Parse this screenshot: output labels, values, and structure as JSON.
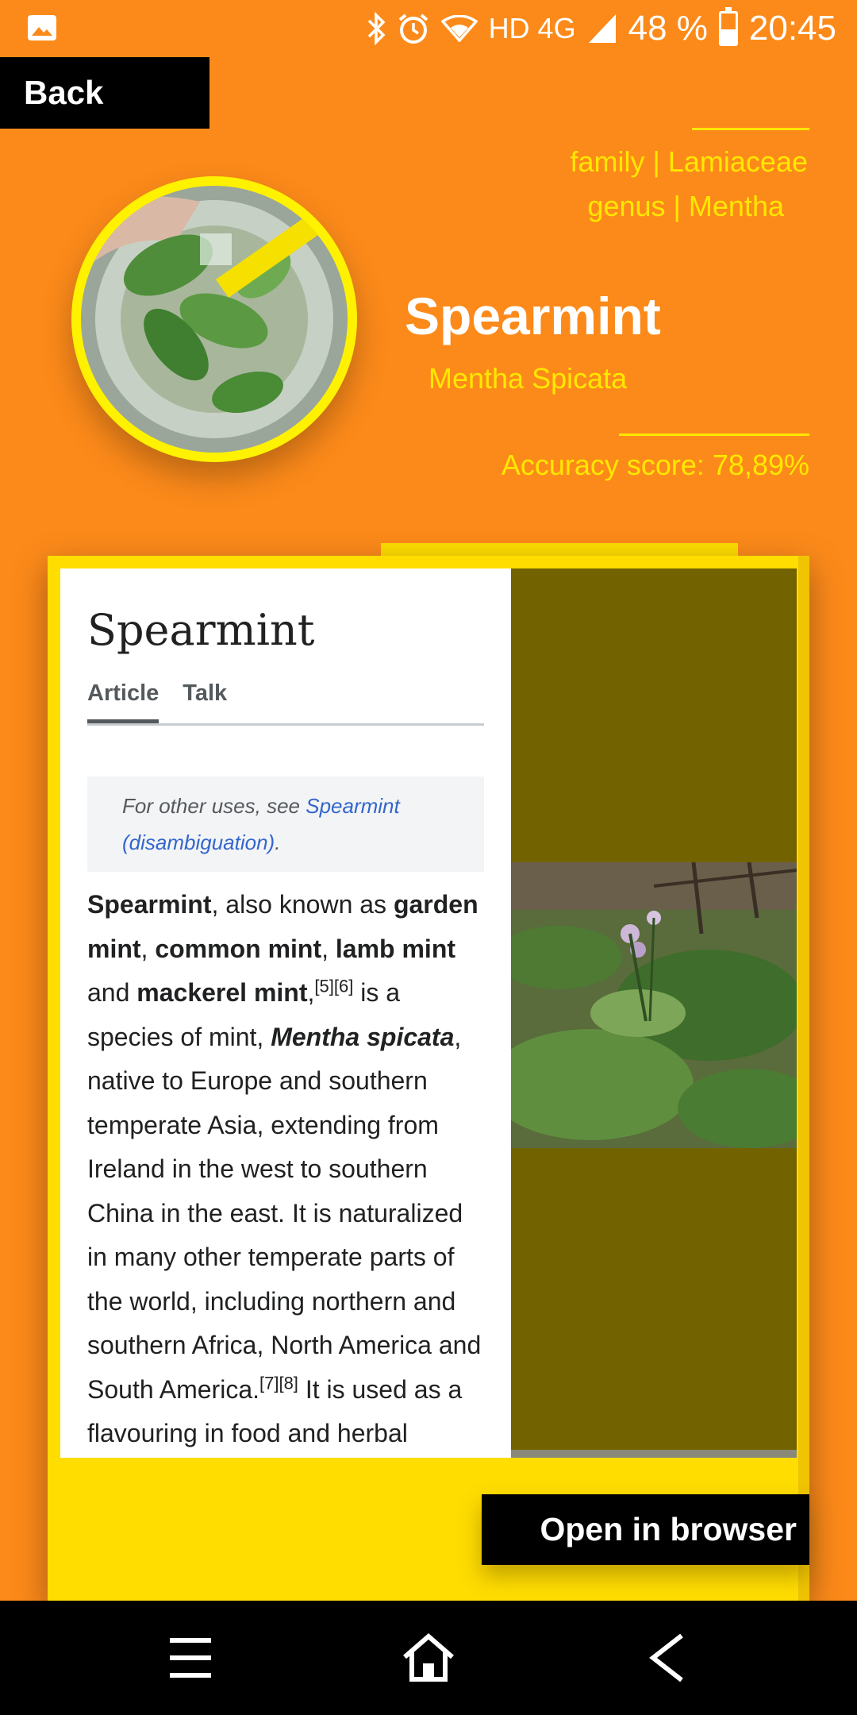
{
  "status_bar": {
    "signal": "HD 4G",
    "battery": "48 %",
    "battery_level": 0.48,
    "time": "20:45",
    "icons": [
      "gallery-icon",
      "bluetooth-icon",
      "alarm-icon",
      "wifi-icon",
      "signal-icon",
      "battery-icon"
    ]
  },
  "header": {
    "back_label": "Back",
    "family": "family | Lamiaceae",
    "genus": "genus | Mentha",
    "common_name": "Spearmint",
    "scientific_name": "Mentha Spicata",
    "accuracy": "Accuracy score: 78,89%",
    "accent_color": "#FFE800",
    "background_color": "#FC8A1A"
  },
  "wiki": {
    "title": "Spearmint",
    "tabs": [
      {
        "label": "Article",
        "active": true
      },
      {
        "label": "Talk",
        "active": false
      }
    ],
    "hatnote_prefix": "For other uses, see ",
    "hatnote_link": "Spearmint (disambiguation)",
    "hatnote_suffix": ".",
    "body": {
      "t1": "Spearmint",
      "t2": ", also known as ",
      "t3": "garden mint",
      "t4": ", ",
      "t5": "common mint",
      "t6": ", ",
      "t7": "lamb mint",
      "t8": " and ",
      "t9": "mackerel mint",
      "t10": ",",
      "sup1": "[5][6]",
      "t11": " is a species of mint, ",
      "t12": "Mentha spicata",
      "t13": ", native to Europe and southern temperate Asia, extending from Ireland in the west to southern China in the east. It is naturalized in many other temperate parts of the world, including northern and southern Africa, North America and South America.",
      "sup2": "[7][8]",
      "t14": " It is used as a flavouring in food and herbal"
    }
  },
  "actions": {
    "open_in_browser": "Open in browser"
  },
  "nav_bar": {
    "icons": [
      "menu-icon",
      "home-icon",
      "back-arrow-icon"
    ]
  }
}
